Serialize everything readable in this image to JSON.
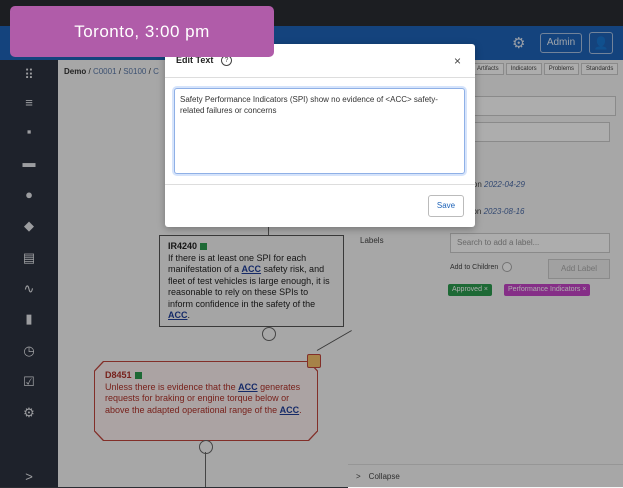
{
  "badge": {
    "text": "Toronto, 3:00 pm"
  },
  "topbar": {
    "settings_icon": "gear-icon",
    "admin_label": "Admin",
    "user_icon": "user-icon"
  },
  "sidebar": {
    "icons": [
      "diagram-icon",
      "menu-icon",
      "alert-square-icon",
      "folder-icon",
      "warning-circle-icon",
      "tag-icon",
      "book-icon",
      "trend-icon",
      "bar-chart-icon",
      "history-icon",
      "clipboard-check-icon",
      "gear-icon",
      "expand-arrow-icon"
    ],
    "expand_glyph": ">"
  },
  "breadcrumb": {
    "root": "Demo",
    "sep": "/",
    "p1": "C0001",
    "p2": "S0100",
    "p3": "C"
  },
  "tabs": [
    "Artifacts",
    "Indicators",
    "Problems",
    "Standards"
  ],
  "right_panel": {
    "select_value": "M",
    "line1_prefix": "r on",
    "line1_date": "2022-04-29",
    "line2_prefix": "t on",
    "line2_date": "2023-08-16",
    "labels_title": "Labels",
    "labels_placeholder": "Search to add a label...",
    "add_children_label": "Add to Children",
    "add_label_button": "Add Label",
    "chips": [
      "Approved ×",
      "Performance Indicators ×"
    ],
    "collapse_label": "Collapse",
    "collapse_glyph": ">"
  },
  "node_a": {
    "id": "IR4240",
    "text_before": "If there is at least one SPI for each manifestation of a ",
    "acc1": "ACC",
    "text_mid": " safety risk, and fleet of test vehicles is large enough, it is reasonable to rely on these SPIs to inform confidence in the safety of the ",
    "acc2": "ACC",
    "text_end": "."
  },
  "node_b": {
    "id": "D8451",
    "text_before": "Unless there is evidence that the ",
    "acc1": "ACC",
    "text_mid": " generates requests for braking or engine torque below or above the adapted operational range of the ",
    "acc2": "ACC",
    "text_end": "."
  },
  "modal": {
    "title": "Edit Text",
    "help_glyph": "?",
    "close_glyph": "×",
    "text_value": "Safety Performance Indicators (SPI) show no evidence of <ACC> safety-related failures or concerns",
    "save_label": "Save"
  },
  "colors": {
    "topbar": "#1e63b8",
    "sidebar": "#2d3340",
    "badge": "#b05ca9",
    "approved": "#2c9b4e",
    "perf_ind": "#c445c8"
  }
}
